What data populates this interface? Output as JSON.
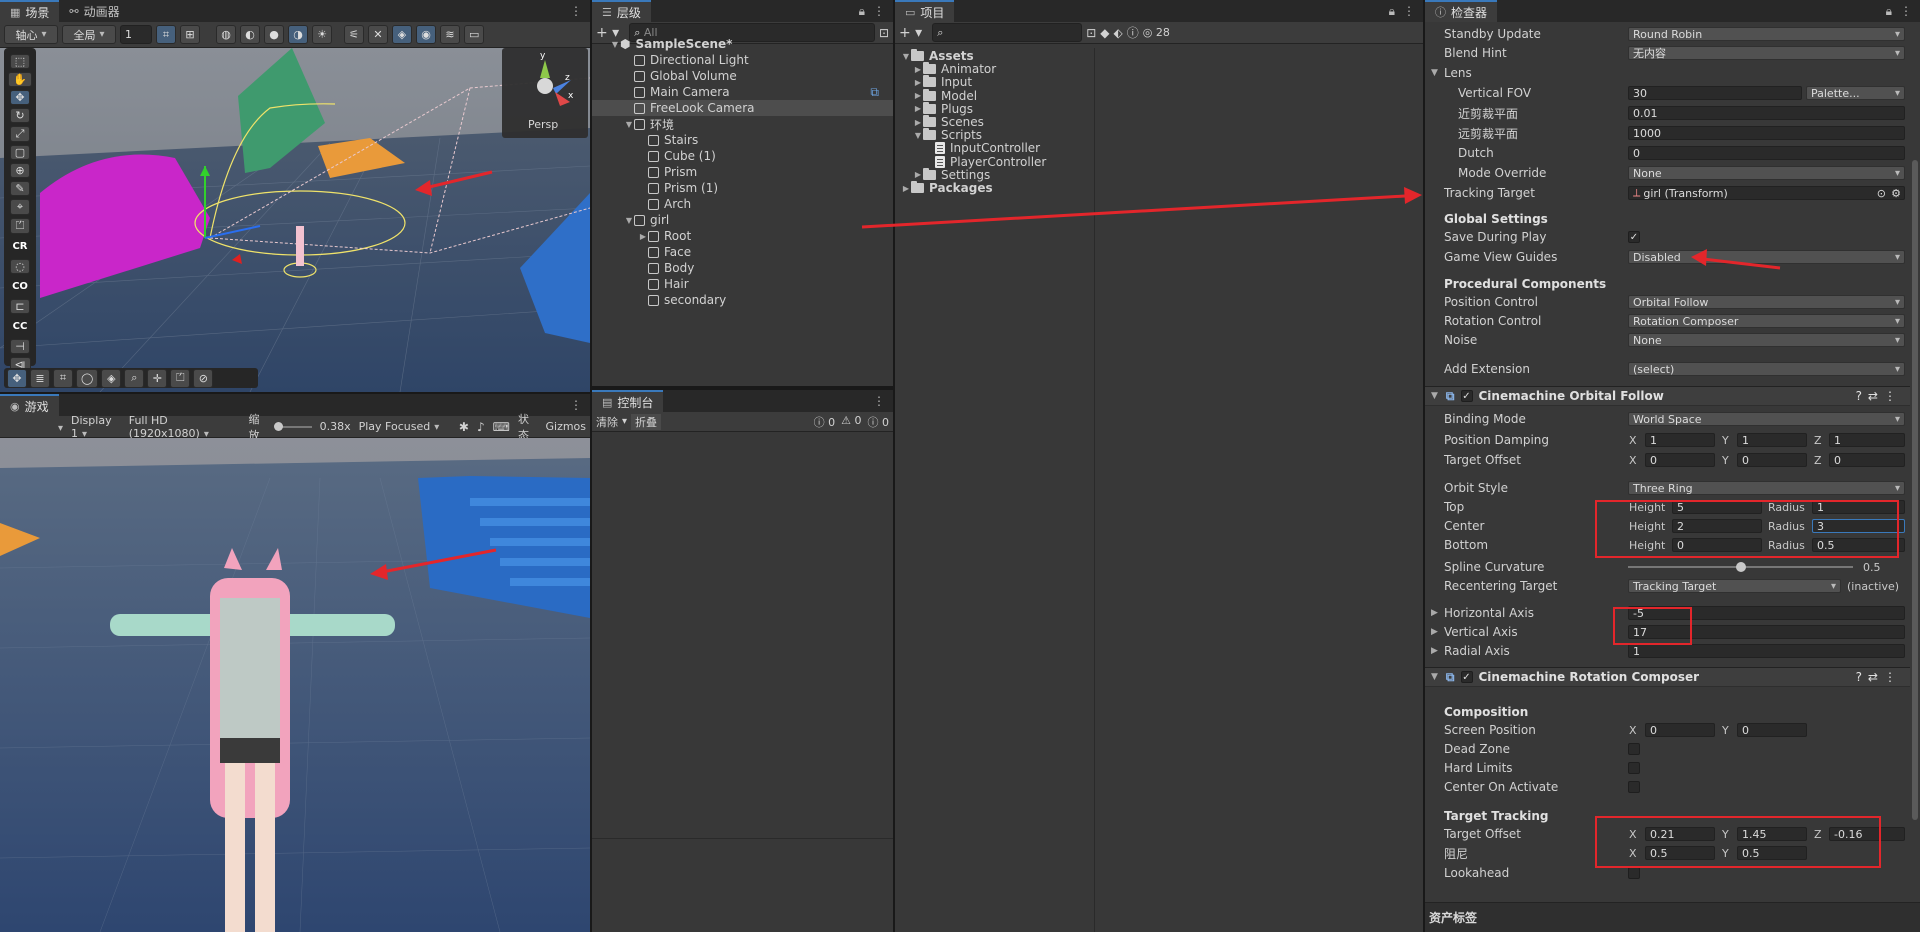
{
  "scene_panel": {
    "tabs": [
      "场景",
      "动画器"
    ],
    "toolbar": {
      "pivot": "轴心",
      "global": "全局",
      "grid_size": "1"
    },
    "gizmo": {
      "persp_label": "Persp",
      "axis_x": "x",
      "axis_y": "y",
      "axis_z": "z"
    },
    "left_tools": [
      "CR",
      "CO",
      "CC"
    ]
  },
  "game_panel": {
    "tab": "游戏",
    "display": "Display 1",
    "resolution": "Full HD (1920x1080)",
    "scale_label": "缩放",
    "scale_value": "0.38x",
    "play_mode": "Play Focused",
    "stats": "状态",
    "gizmos": "Gizmos"
  },
  "hierarchy": {
    "tab": "层级",
    "search_placeholder": "All",
    "items": [
      {
        "label": "SampleScene*",
        "depth": 0,
        "kind": "scene",
        "expanded": true
      },
      {
        "label": "Directional Light",
        "depth": 1,
        "kind": "go"
      },
      {
        "label": "Global Volume",
        "depth": 1,
        "kind": "go"
      },
      {
        "label": "Main Camera",
        "depth": 1,
        "kind": "go"
      },
      {
        "label": "FreeLook Camera",
        "depth": 1,
        "kind": "go",
        "selected": true
      },
      {
        "label": "环境",
        "depth": 1,
        "kind": "go",
        "expanded": true
      },
      {
        "label": "Stairs",
        "depth": 2,
        "kind": "go"
      },
      {
        "label": "Cube (1)",
        "depth": 2,
        "kind": "go"
      },
      {
        "label": "Prism",
        "depth": 2,
        "kind": "go"
      },
      {
        "label": "Prism (1)",
        "depth": 2,
        "kind": "go"
      },
      {
        "label": "Arch",
        "depth": 2,
        "kind": "go"
      },
      {
        "label": "girl",
        "depth": 1,
        "kind": "go",
        "expanded": true
      },
      {
        "label": "Root",
        "depth": 2,
        "kind": "go",
        "collapsed": true
      },
      {
        "label": "Face",
        "depth": 2,
        "kind": "go"
      },
      {
        "label": "Body",
        "depth": 2,
        "kind": "go"
      },
      {
        "label": "Hair",
        "depth": 2,
        "kind": "go"
      },
      {
        "label": "secondary",
        "depth": 2,
        "kind": "go"
      }
    ]
  },
  "console": {
    "tab": "控制台",
    "clear": "清除",
    "collapse": "折叠",
    "counts": [
      "0",
      "0",
      "0"
    ]
  },
  "project": {
    "tab": "项目",
    "hidden_count": "28",
    "items": [
      {
        "label": "Assets",
        "depth": 0,
        "kind": "folder",
        "expanded": true
      },
      {
        "label": "Animator",
        "depth": 1,
        "kind": "folder"
      },
      {
        "label": "Input",
        "depth": 1,
        "kind": "folder"
      },
      {
        "label": "Model",
        "depth": 1,
        "kind": "folder"
      },
      {
        "label": "Plugs",
        "depth": 1,
        "kind": "folder"
      },
      {
        "label": "Scenes",
        "depth": 1,
        "kind": "folder"
      },
      {
        "label": "Scripts",
        "depth": 1,
        "kind": "folder",
        "expanded": true
      },
      {
        "label": "InputController",
        "depth": 2,
        "kind": "script"
      },
      {
        "label": "PlayerController",
        "depth": 2,
        "kind": "script"
      },
      {
        "label": "Settings",
        "depth": 1,
        "kind": "folder"
      },
      {
        "label": "Packages",
        "depth": 0,
        "kind": "folder"
      }
    ]
  },
  "inspector": {
    "tab": "检查器",
    "footer": "资产标签",
    "standby_update": {
      "label": "Standby Update",
      "value": "Round Robin"
    },
    "blend_hint": {
      "label": "Blend Hint",
      "value": "无内容"
    },
    "lens": {
      "label": "Lens",
      "vertical_fov": {
        "label": "Vertical FOV",
        "value": "30",
        "preset": "Palette..."
      },
      "near": {
        "label": "近剪裁平面",
        "value": "0.01"
      },
      "far": {
        "label": "远剪裁平面",
        "value": "1000"
      },
      "dutch": {
        "label": "Dutch",
        "value": "0"
      },
      "mode_override": {
        "label": "Mode Override",
        "value": "None"
      }
    },
    "tracking_target": {
      "label": "Tracking Target",
      "value": "girl (Transform)"
    },
    "global_settings": {
      "title": "Global Settings",
      "save_during_play": {
        "label": "Save During Play",
        "check": "✓"
      },
      "game_view_guides": {
        "label": "Game View Guides",
        "value": "Disabled"
      }
    },
    "procedural": {
      "title": "Procedural Components",
      "position_control": {
        "label": "Position Control",
        "value": "Orbital Follow"
      },
      "rotation_control": {
        "label": "Rotation Control",
        "value": "Rotation Composer"
      },
      "noise": {
        "label": "Noise",
        "value": "None"
      },
      "add_extension": {
        "label": "Add Extension",
        "value": "(select)"
      }
    },
    "orbital_follow": {
      "title": "Cinemachine Orbital Follow",
      "binding_mode": {
        "label": "Binding Mode",
        "value": "World Space"
      },
      "position_damping": {
        "label": "Position Damping",
        "x": "1",
        "y": "1",
        "z": "1"
      },
      "target_offset": {
        "label": "Target Offset",
        "x": "0",
        "y": "0",
        "z": "0"
      },
      "orbit_style": {
        "label": "Orbit Style",
        "value": "Three Ring"
      },
      "height_label": "Height",
      "radius_label": "Radius",
      "top": {
        "label": "Top",
        "height": "5",
        "radius": "1"
      },
      "center": {
        "label": "Center",
        "height": "2",
        "radius": "3"
      },
      "bottom": {
        "label": "Bottom",
        "height": "0",
        "radius": "0.5"
      },
      "spline_curvature": {
        "label": "Spline Curvature",
        "value": "0.5",
        "fraction": 0.5
      },
      "recentering_target": {
        "label": "Recentering Target",
        "value": "Tracking Target",
        "status": "(inactive)"
      },
      "horizontal_axis": {
        "label": "Horizontal Axis",
        "value": "-5"
      },
      "vertical_axis": {
        "label": "Vertical Axis",
        "value": "17"
      },
      "radial_axis": {
        "label": "Radial Axis",
        "value": "1"
      }
    },
    "rotation_composer": {
      "title": "Cinemachine Rotation Composer",
      "composition": "Composition",
      "screen_position": {
        "label": "Screen Position",
        "x": "0",
        "y": "0"
      },
      "dead_zone": {
        "label": "Dead Zone"
      },
      "hard_limits": {
        "label": "Hard Limits"
      },
      "center_on_activate": {
        "label": "Center On Activate"
      },
      "target_tracking": "Target Tracking",
      "target_offset": {
        "label": "Target Offset",
        "x": "0.21",
        "y": "1.45",
        "z": "-0.16"
      },
      "damping": {
        "label": "阻尼",
        "x": "0.5",
        "y": "0.5"
      },
      "lookahead": {
        "label": "Lookahead"
      }
    }
  },
  "colors": {
    "annotation_red": "#e3262b",
    "selection": "#3a79bb"
  }
}
